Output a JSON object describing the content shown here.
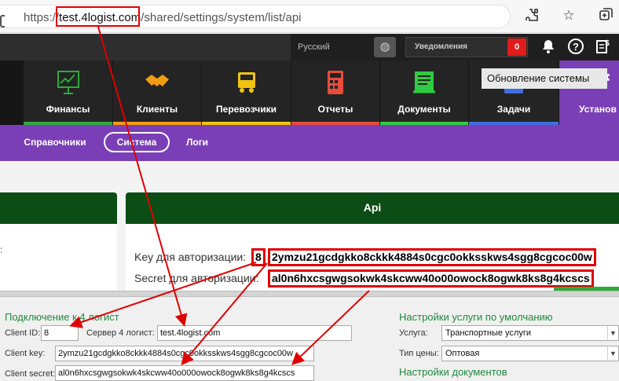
{
  "browser": {
    "url_scheme": "https://",
    "url_host": "test.4logist.com",
    "url_path": "/shared/settings/system/list/api"
  },
  "topbar": {
    "language": "Русский",
    "notifications_label": "Уведомления",
    "notifications_count": "0",
    "tooltip": "Обновление системы"
  },
  "modules": [
    {
      "label": "Финансы",
      "color": "#2eaa3b",
      "icon": "chart-icon"
    },
    {
      "label": "Клиенты",
      "color": "#f39c12",
      "icon": "handshake-icon"
    },
    {
      "label": "Перевозчики",
      "color": "#f1c40f",
      "icon": "truck-icon"
    },
    {
      "label": "Отчеты",
      "color": "#e74c3c",
      "icon": "calculator-icon"
    },
    {
      "label": "Документы",
      "color": "#2ecc40",
      "icon": "document-icon"
    },
    {
      "label": "Задачи",
      "color": "#3f6ee0",
      "icon": "tasks-icon"
    },
    {
      "label": "Установ",
      "color": "#7a3fb6",
      "icon": "gear-icon"
    }
  ],
  "subnav": {
    "items": [
      "Справочники",
      "Система",
      "Логи"
    ],
    "active": "Система"
  },
  "api": {
    "title": "Api",
    "key_label": "Key для авторизации:",
    "client_id": "8",
    "key_value": "2ymzu21gcdgkko8ckkk4884s0cgc0okksskws4sgg8cgcoc00w",
    "secret_label": "Secret для авторизации:",
    "secret_value": "al0n6hxcsgwgsokwk4skcww40o00owock8ogwk8ks8g4kcscs"
  },
  "connection": {
    "title": "Подключение к 4 логист",
    "client_id_label": "Client ID:",
    "client_id_value": "8",
    "server_label": "Сервер 4 логист:",
    "server_value": "test.4logist.com",
    "client_key_label": "Client key:",
    "client_key_value": "2ymzu21gcdgkko8ckkk4884s0cgc0okksskws4sgg8cgcoc00w",
    "client_secret_label": "Client secret:",
    "client_secret_value": "al0n6hxcsgwgsokwk4skcww40o000owock8ogwk8ks8g4kcscs"
  },
  "service_defaults": {
    "title": "Настройки услуги по умолчанию",
    "service_label": "Услуга:",
    "service_value": "Транспортные услуги",
    "price_type_label": "Тип цены:",
    "price_type_value": "Оптовая",
    "documents_title": "Настройки документов"
  }
}
